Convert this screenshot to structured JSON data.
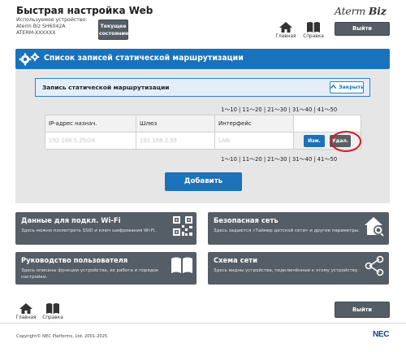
{
  "header": {
    "app_title": "Быстрая настройка Web",
    "device_line1": "Используемое устройство:",
    "device_line2": "Aterm Biz SH6042A",
    "device_line3": "ATERM-XXXXXX",
    "state_button_line1": "Текущее",
    "state_button_line2": "состояние",
    "home_label": "Главная",
    "help_label": "Справка",
    "logout_label": "Выйти",
    "brand_a": "Aterm",
    "brand_b": "Biz"
  },
  "page": {
    "title": "Список записей статической маршрутизации"
  },
  "entry_section": {
    "title": "Запись статической маршрутизации",
    "close_label": "Закрыть"
  },
  "pagination": {
    "links": [
      "1～10",
      "11～20",
      "21～30",
      "31～40",
      "41～50"
    ],
    "separator": "|"
  },
  "routes_table": {
    "columns": [
      "IP-адрес назнач.",
      "Шлюз",
      "Интерфейс",
      ""
    ],
    "rows": [
      {
        "destination": "192.168.5.25/24",
        "gateway": "192.168.2.55",
        "interface": "LAN",
        "edit_label": "Изм.",
        "delete_label": "Удал."
      }
    ]
  },
  "add_button": "Добавить",
  "tiles": [
    {
      "title": "Данные для подкл. Wi-Fi",
      "desc": "Здесь можно посмотреть SSID и ключ шифрования Wi-Fi.",
      "icon": "qr-code-icon"
    },
    {
      "title": "Безопасная сеть",
      "desc": "Здесь задаются «Таймер детской сети» и другие параметры.",
      "icon": "house-shield-icon"
    },
    {
      "title": "Руководство пользователя",
      "desc": "Здесь описаны функции устройства, их работа и порядок настройки.",
      "icon": "open-book-icon"
    },
    {
      "title": "Схема сети",
      "desc": "Здесь видны устройства, подключённые к этому устройству.",
      "icon": "network-share-icon"
    }
  ],
  "footer": {
    "home_label": "Главная",
    "help_label": "Справка",
    "logout_label": "Выйти",
    "copyright": "Copyright© NEC Platforms, Ltd. 2001-2025",
    "logo": "NEC"
  },
  "colors": {
    "primary_blue": "#1a72bb",
    "dark_gray": "#555d66",
    "highlight_red": "#e0161c",
    "panel_gray": "#e6e6e6"
  }
}
